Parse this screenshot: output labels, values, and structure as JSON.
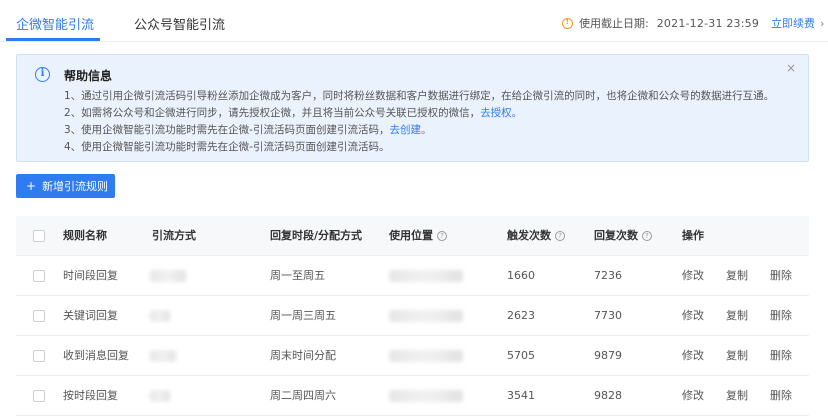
{
  "tabs": [
    {
      "label": "企微智能引流",
      "active": true
    },
    {
      "label": "公众号智能引流",
      "active": false
    }
  ],
  "expiry": {
    "label": "使用截止日期:",
    "date": "2021-12-31 23:59",
    "renew_label": "立即续费",
    "chevron": "›"
  },
  "help": {
    "title": "帮助信息",
    "close": "×",
    "line1": "1、通过引用企微引流活码引导粉丝添加企微成为客户，同时将粉丝数据和客户数据进行绑定，在给企微引流的同时，也将企微和公众号的数据进行互通。",
    "line2_text": "2、如需将公众号和企微进行同步，请先授权企微，并且将当前公众号关联已授权的微信，",
    "line2_link": "去授权。",
    "line3_text": "3、使用企微智能引流功能时需先在企微-引流活码页面创建引流活码，",
    "line3_link": "去创建。",
    "line4": "4、使用企微智能引流功能时需先在企微-引流活码页面创建引流活码。"
  },
  "add_button": {
    "plus": "+",
    "label": "新增引流规则"
  },
  "table": {
    "headers": {
      "name": "规则名称",
      "method": "引流方式",
      "period": "回复时段/分配方式",
      "position": "使用位置",
      "triggers": "触发次数",
      "replies": "回复次数",
      "actions": "操作"
    },
    "help_glyph": "?",
    "rows": [
      {
        "name": "时间段回复",
        "period": "周一至周五",
        "triggers": "1660",
        "replies": "7236",
        "edit": "修改",
        "copy": "复制",
        "delete": "删除"
      },
      {
        "name": "关键词回复",
        "period": "周一周三周五",
        "triggers": "2623",
        "replies": "7730",
        "edit": "修改",
        "copy": "复制",
        "delete": "删除"
      },
      {
        "name": "收到消息回复",
        "period": "周末时间分配",
        "triggers": "5705",
        "replies": "9879",
        "edit": "修改",
        "copy": "复制",
        "delete": "删除"
      },
      {
        "name": "按时段回复",
        "period": "周二周四周六",
        "triggers": "3541",
        "replies": "9828",
        "edit": "修改",
        "copy": "复制",
        "delete": "删除"
      }
    ]
  },
  "colors": {
    "accent": "#2f7bf2",
    "warning": "#f0a020",
    "help_bg": "#eaf2fd"
  }
}
